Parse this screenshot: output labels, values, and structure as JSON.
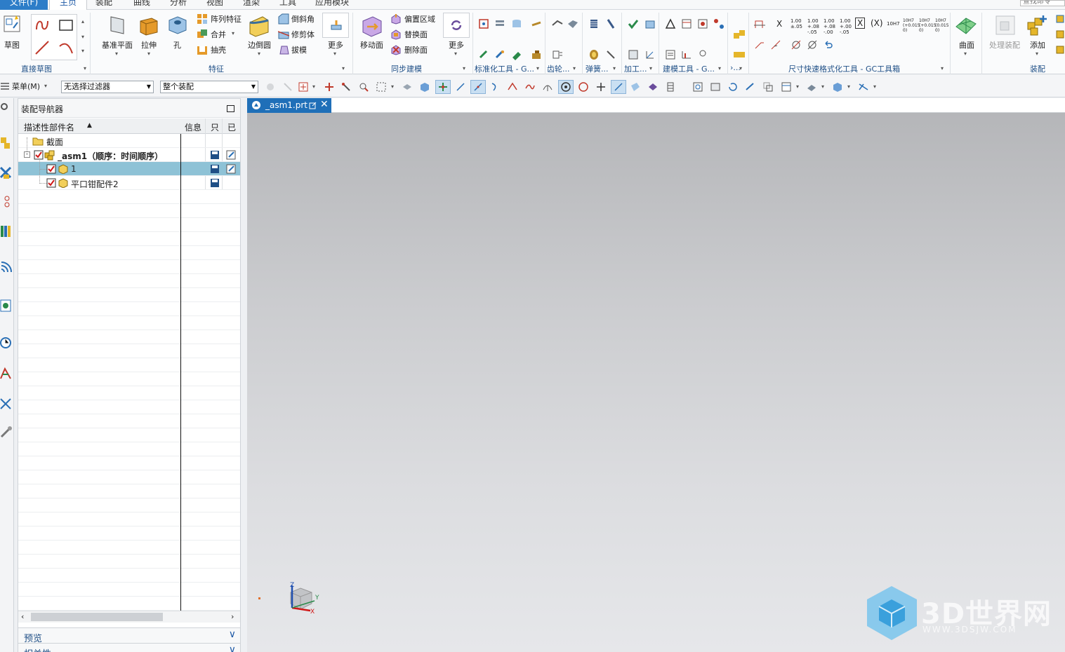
{
  "tabs": [
    "文件(F)",
    "主页",
    "装配",
    "曲线",
    "分析",
    "视图",
    "渲染",
    "工具",
    "应用模块"
  ],
  "search": {
    "placeholder": "查找命令"
  },
  "ribbon": {
    "sketch": {
      "label": "草图",
      "group": "直接草图"
    },
    "feature": {
      "datum_plane": "基准平面",
      "extrude": "拉伸",
      "hole": "孔",
      "pattern_feature": "阵列特征",
      "unite": "合并",
      "shell": "抽壳",
      "edge_blend": "边倒圆",
      "chamfer": "倒斜角",
      "trim_body": "修剪体",
      "draft": "拔模",
      "more": "更多",
      "group": "特征"
    },
    "sync": {
      "move_face": "移动面",
      "offset_region": "偏置区域",
      "replace_face": "替换面",
      "delete_face": "删除面",
      "more": "更多",
      "group": "同步建模"
    },
    "groups": {
      "std_tools": "标准化工具 - G...",
      "gear": "齿轮...",
      "spring": "弹簧...",
      "machining": "加工...",
      "modeling_tools": "建模工具 - G...",
      "misc": "›...",
      "dim_format": "尺寸快速格式化工具 - GC工具箱",
      "surface_label": "曲面",
      "assembly": "装配"
    },
    "assembly": {
      "process_assembly": "处理装配",
      "add": "添加"
    }
  },
  "dim_labels": [
    "X",
    "1.00 ±.05",
    "1.00 +.08 -.05",
    "1.00 +.08 -.00",
    "1.00 +.00 -.05",
    "X",
    "(X)",
    "10H7",
    "10H7 (+0.015 0)",
    "10H7 (+0.015 0)",
    "10H7 (0.015 0)"
  ],
  "toolbar2": {
    "menu": "菜单(M)",
    "filter": "无选择过滤器",
    "scope": "整个装配"
  },
  "navigator": {
    "title": "装配导航器",
    "columns": {
      "name": "描述性部件名",
      "info": "信息",
      "readonly": "只",
      "modified": "已"
    },
    "rows": [
      {
        "name": "截面",
        "level": 1,
        "checked": false,
        "selected": false
      },
      {
        "name": "_asm1（顺序：时间顺序）",
        "level": 1,
        "checked": true,
        "selected": false
      },
      {
        "name": "1",
        "level": 2,
        "checked": true,
        "selected": true
      },
      {
        "name": "平口钳配件2",
        "level": 2,
        "checked": true,
        "selected": false
      }
    ],
    "panels": {
      "preview": "预览",
      "dependencies": "相关性"
    }
  },
  "document": {
    "tab": "_asm1.prt"
  },
  "triad": {
    "z": "Z",
    "y": "Y",
    "x": "X"
  },
  "watermark": {
    "brand": "3D世界网",
    "url": "WWW.3DSJW.COM"
  },
  "colors": {
    "accent": "#1f6fb8",
    "selection": "#8ec2d6",
    "file_tab": "#2d7dc8"
  }
}
